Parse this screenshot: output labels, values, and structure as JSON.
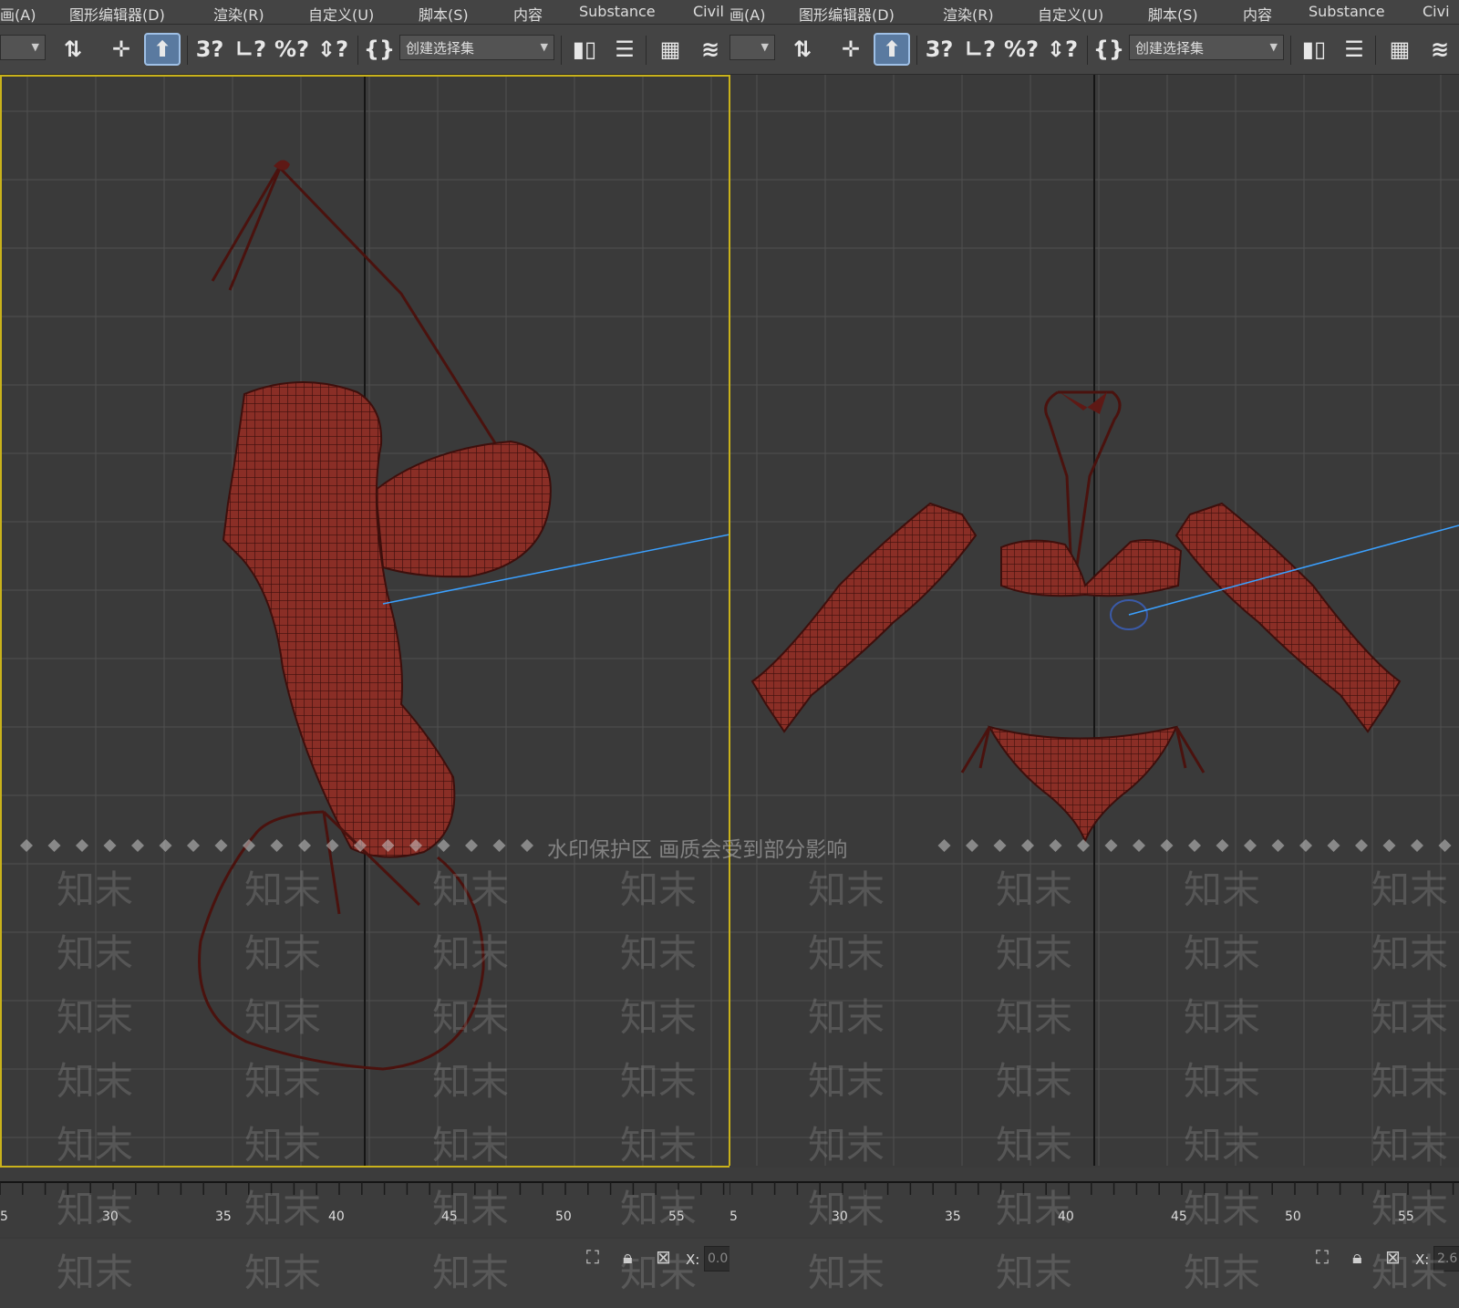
{
  "menu": [
    "画(A)",
    "图形编辑器(D)",
    "渲染(R)",
    "自定义(U)",
    "脚本(S)",
    "内容",
    "Substance",
    "Civil",
    "画(A)",
    "图形编辑器(D)",
    "渲染(R)",
    "自定义(U)",
    "脚本(S)",
    "内容",
    "Substance",
    "Civi"
  ],
  "toolbar": {
    "selection_set_placeholder": "创建选择集",
    "icons": [
      "select-link-icon",
      "move-icon",
      "select-object-icon",
      "angle-snap-icon",
      "percent-snap-icon",
      "spinner-snap-icon",
      "named-selection-icon",
      "mirror-icon",
      "align-icon",
      "layer-explorer-icon",
      "layer-icon"
    ]
  },
  "viewports": {
    "left": {
      "mesh_color": "#8a2e26",
      "view": "side"
    },
    "right": {
      "mesh_color": "#8a2e26",
      "view": "front"
    }
  },
  "timeline": {
    "ticks": [
      "5",
      "30",
      "35",
      "40",
      "45",
      "50",
      "55",
      "5",
      "30",
      "35",
      "40",
      "45",
      "50",
      "55"
    ]
  },
  "status": {
    "left_x_label": "X:",
    "left_x_value": "0.0",
    "right_x_label": "X:",
    "right_x_value": "2.6"
  },
  "watermark": {
    "notice": "水印保护区  画质会受到部分影响",
    "text": "知末"
  },
  "colors": {
    "active_border": "#c9b21b",
    "grid": "#505050",
    "axis": "#151515",
    "link_line": "#3aa0ff"
  }
}
